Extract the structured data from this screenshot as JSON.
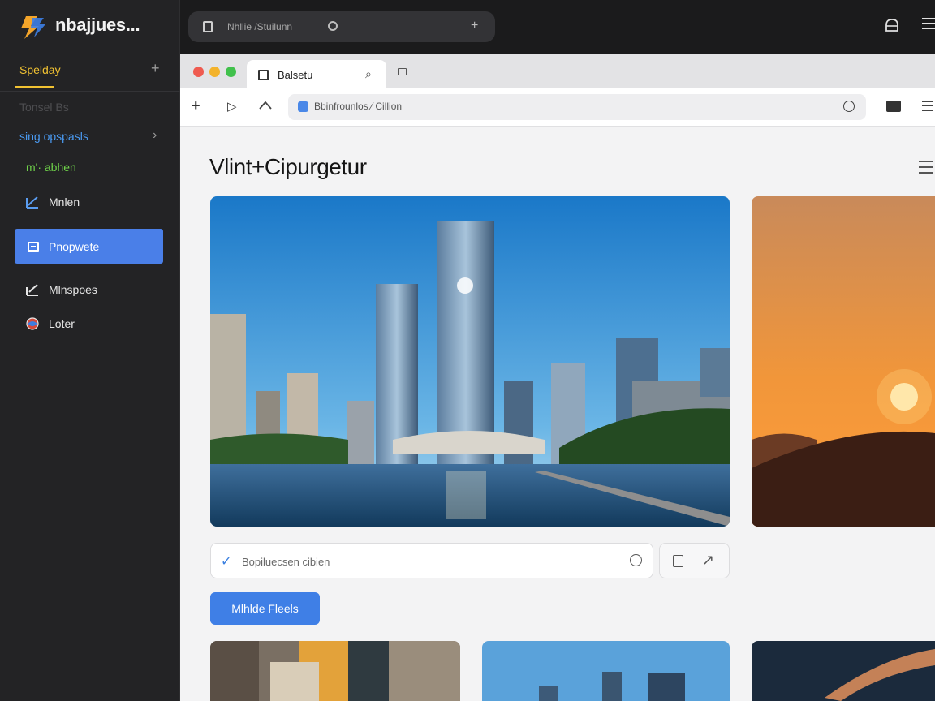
{
  "app": {
    "name": "nbajjues...",
    "colors": {
      "accent": "#4a7fe8",
      "section": "#f1c232",
      "link": "#4a9af2",
      "green": "#6fd24a"
    }
  },
  "sidebar": {
    "section_label": "Spelday",
    "faded_label": "Tonsel Bs",
    "link_label": "sing opspasls",
    "green_label": "m'· abhen",
    "items": [
      {
        "label": "Mnlen",
        "icon": "chart-icon"
      },
      {
        "label": "Pnopwete",
        "icon": "card-icon",
        "active": true
      },
      {
        "label": "Mlnspoes",
        "icon": "check-chart-icon"
      },
      {
        "label": "Loter",
        "icon": "globe-icon"
      }
    ]
  },
  "topbar": {
    "search_text": "Nhllie /Stuilunn"
  },
  "browser": {
    "tab_title": "Balsetu",
    "url": "Bbinfrounlos ⁄ Cillion"
  },
  "page": {
    "title": "Vlint+Cipurgetur",
    "search_placeholder": "Bopiluecsen cibien",
    "primary_button": "Mlhlde Fleels"
  }
}
